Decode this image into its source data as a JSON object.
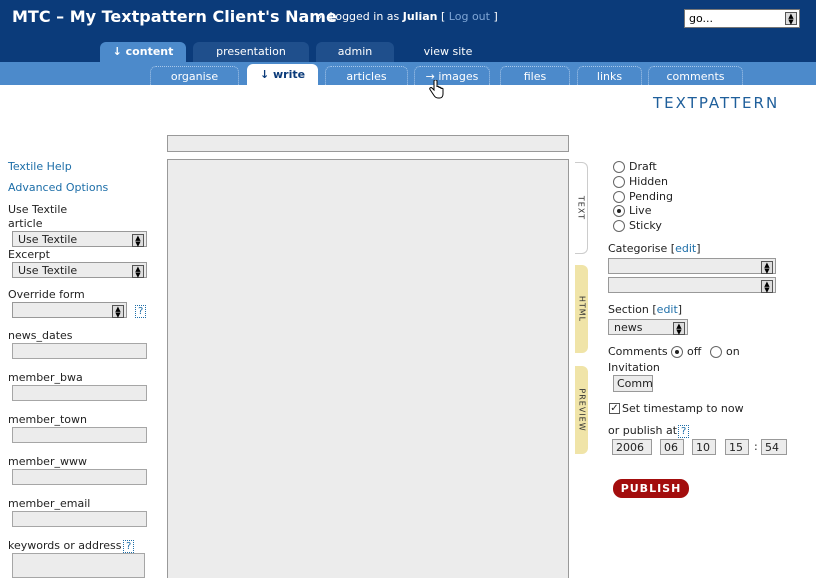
{
  "header": {
    "site_title": "MTC – My Textpattern Client's Name",
    "chevron": "›",
    "logged_in_prefix": "Logged in as",
    "user": "Julian",
    "bracket_open": "[",
    "logout": "Log out",
    "bracket_close": "]",
    "go_select": "go...",
    "brand": "TEXTPATTERN"
  },
  "main_tabs": [
    "↓ content",
    "presentation",
    "admin",
    "view site"
  ],
  "sub_tabs": [
    "organise",
    "↓ write",
    "articles",
    "→ images",
    "files",
    "links",
    "comments"
  ],
  "left": {
    "textile_help": "Textile Help",
    "advanced_options": "Advanced Options",
    "use_textile_label": "Use Textile",
    "article_label": "article",
    "article_select": "Use Textile",
    "excerpt_label": "Excerpt",
    "excerpt_select": "Use Textile",
    "override_form_label": "Override form",
    "help_mark": "?",
    "custom_fields": [
      "news_dates",
      "member_bwa",
      "member_town",
      "member_www",
      "member_email"
    ],
    "keywords_label": "keywords or address"
  },
  "editor_tabs": [
    "TEXT",
    "HTML",
    "PREVIEW"
  ],
  "right": {
    "status_options": [
      "Draft",
      "Hidden",
      "Pending",
      "Live",
      "Sticky"
    ],
    "status_selected": "Live",
    "categorise_label": "Categorise",
    "edit_link": "edit",
    "section_label": "Section",
    "section_select": "news",
    "comments_label": "Comments",
    "comments_off": "off",
    "comments_on": "on",
    "invitation_label": "Invitation",
    "invitation_value": "Comm",
    "timestamp_label": "Set timestamp to now",
    "publish_at_label": "or publish at",
    "date_year": "2006",
    "date_month": "06",
    "date_day": "10",
    "time_hour": "15",
    "time_colon": ":",
    "time_minute": "54",
    "publish_button": "PUBLISH"
  }
}
